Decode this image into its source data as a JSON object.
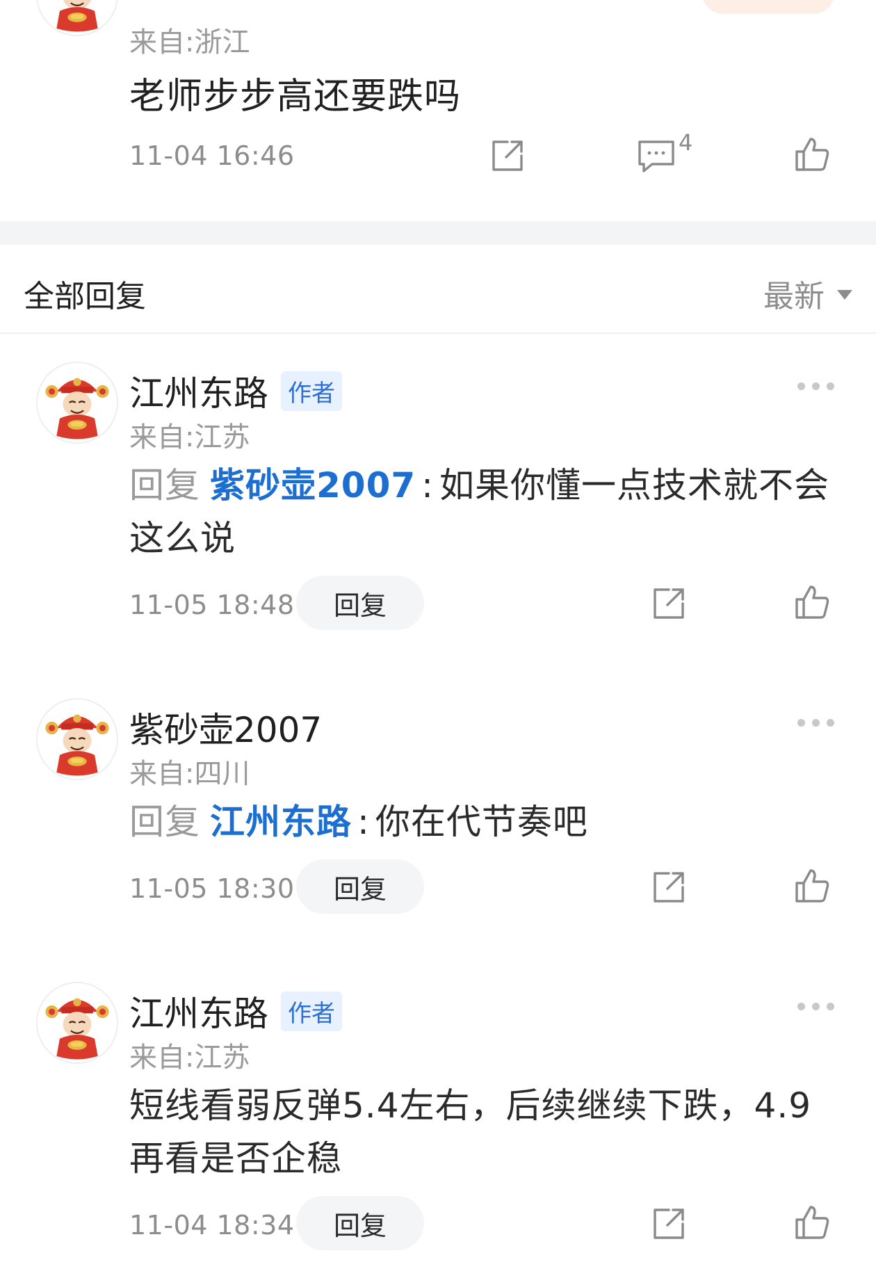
{
  "top_post": {
    "from": "来自:浙江",
    "text": "老师步步高还要跌吗",
    "time": "11-04 16:46",
    "comment_count": "4"
  },
  "section": {
    "title": "全部回复",
    "sort_label": "最新"
  },
  "replies": [
    {
      "name": "江州东路",
      "author_tag": "作者",
      "from": "来自:江苏",
      "reply_label": "回复",
      "reply_to": "紫砂壶2007",
      "colon": ":",
      "text": "如果你懂一点技术就不会这么说",
      "time": "11-05 18:48",
      "reply_button": "回复"
    },
    {
      "name": "紫砂壶2007",
      "from": "来自:四川",
      "reply_label": "回复",
      "reply_to": "江州东路",
      "colon": ":",
      "text": "你在代节奏吧",
      "time": "11-05 18:30",
      "reply_button": "回复"
    },
    {
      "name": "江州东路",
      "author_tag": "作者",
      "from": "来自:江苏",
      "text": "短线看弱反弹5.4左右，后续继续下跌，4.9再看是否企稳",
      "time": "11-04 18:34",
      "reply_button": "回复"
    }
  ],
  "icons": {
    "share": "share-icon",
    "comment": "comment-icon",
    "like": "thumbs-up-icon",
    "more": "more-dots-icon",
    "avatar": "god-of-wealth-avatar"
  },
  "colors": {
    "link_blue": "#1c6fd1",
    "author_tag_bg": "#e8f1ff",
    "muted": "#8c8c8c"
  }
}
